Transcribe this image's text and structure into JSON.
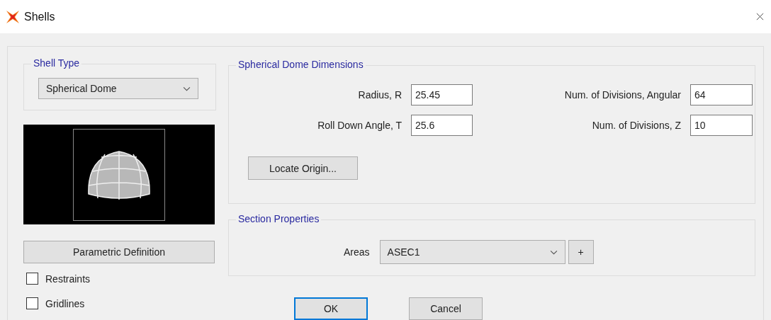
{
  "window": {
    "title": "Shells"
  },
  "shell_type": {
    "title": "Shell Type",
    "dropdown": {
      "value": "Spherical Dome"
    }
  },
  "preview": {
    "kind": "dome"
  },
  "parametric_button": "Parametric Definition",
  "checkboxes": [
    {
      "label": "Restraints",
      "checked": false
    },
    {
      "label": "Gridlines",
      "checked": false
    }
  ],
  "dimensions": {
    "title": "Spherical Dome Dimensions",
    "fields": [
      {
        "label": "Radius, R",
        "value": "25.45"
      },
      {
        "label": "Num. of Divisions, Angular",
        "value": "64"
      },
      {
        "label": "Roll Down Angle, T",
        "value": "25.6"
      },
      {
        "label": "Num. of Divisions, Z",
        "value": "10"
      }
    ],
    "button": "Locate Origin..."
  },
  "section": {
    "title": "Section Properties",
    "label": "Areas",
    "dropdown": {
      "value": "ASEC1"
    },
    "add_button": "+"
  },
  "buttons": [
    {
      "label": "OK",
      "focused": true
    },
    {
      "label": "Cancel",
      "focused": false
    }
  ]
}
